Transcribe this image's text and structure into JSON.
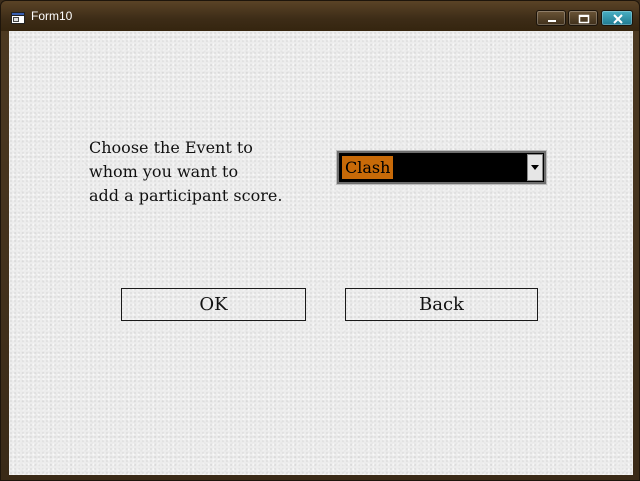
{
  "window": {
    "title": "Form10",
    "icon": "form-window-icon",
    "controls": {
      "minimize": "minimize-icon",
      "maximize": "maximize-icon",
      "close": "close-icon"
    }
  },
  "form": {
    "prompt_lines": [
      "Choose the Event to",
      "whom you want to",
      "add a participant score."
    ],
    "event_select": {
      "selected_value": "Clash",
      "highlight_color": "#c86a08",
      "background_color": "#000000"
    },
    "ok_label": "OK",
    "back_label": "Back"
  }
}
